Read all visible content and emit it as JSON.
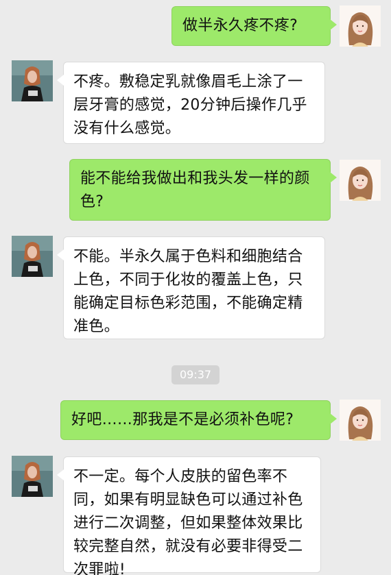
{
  "messages": [
    {
      "side": "right",
      "text": "做半永久疼不疼?"
    },
    {
      "side": "left",
      "text": "不疼。敷稳定乳就像眉毛上涂了一层牙膏的感觉，20分钟后操作几乎没有什么感觉。"
    },
    {
      "side": "right",
      "text": "能不能给我做出和我头发一样的颜色?"
    },
    {
      "side": "left",
      "text": "不能。半永久属于色料和细胞结合上色，不同于化妆的覆盖上色，只能确定目标色彩范围，不能确定精准色。"
    },
    {
      "side": "right",
      "text": "好吧……那我是不是必须补色呢?"
    },
    {
      "side": "left",
      "text": "不一定。每个人皮肤的留色率不同，如果有明显缺色可以通过补色进行二次调整，但如果整体效果比较完整自然，就没有必要非得受二次罪啦!"
    }
  ],
  "timestamp": "09:37",
  "colors": {
    "background": "#ebebeb",
    "sent_bubble": "#9de96a",
    "received_bubble": "#ffffff"
  },
  "avatars": {
    "user": "woman-cartoon-avatar-icon",
    "artist": "woman-photo-avatar-icon"
  }
}
